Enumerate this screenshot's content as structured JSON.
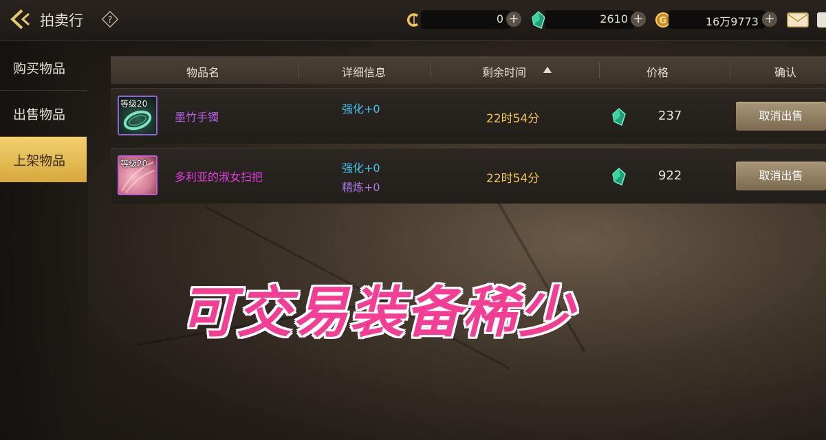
{
  "header": {
    "title": "拍卖行",
    "help_icon": "question-mark-icon",
    "currencies": [
      {
        "icon": "c-coin-icon",
        "value": "0",
        "color": "#f0c64a"
      },
      {
        "icon": "green-gem-icon",
        "value": "2610",
        "color": "#3fd3a0"
      },
      {
        "icon": "gold-coin-icon",
        "value": "16万9773",
        "color": "#e0a73a"
      }
    ],
    "mail_icon": "envelope-icon"
  },
  "sidebar": {
    "items": [
      {
        "label": "购买物品",
        "active": false
      },
      {
        "label": "出售物品",
        "active": false
      },
      {
        "label": "上架物品",
        "active": true
      }
    ]
  },
  "table": {
    "columns": [
      "物品名",
      "详细信息",
      "剩余时间",
      "价格",
      "确认"
    ],
    "sort_column": "剩余时间",
    "rows": [
      {
        "level": "等级20",
        "name": "墨竹手镯",
        "name_color": "#b45fe0",
        "details": [
          "强化+0"
        ],
        "time_left": "22时54分",
        "price": "237",
        "action": "取消出售"
      },
      {
        "level": "等级20",
        "name": "多利亚的淑女扫把",
        "name_color": "#e23fe0",
        "details": [
          "强化+0",
          "精炼+0"
        ],
        "time_left": "22时54分",
        "price": "922",
        "action": "取消出售"
      }
    ]
  },
  "overlay_caption": "可交易装备稀少",
  "colors": {
    "accent_gold": "#f2c84b",
    "detail_cyan": "#3fc6f0",
    "detail_purple": "#b07ae8",
    "caption_pink": "#f43e93"
  }
}
